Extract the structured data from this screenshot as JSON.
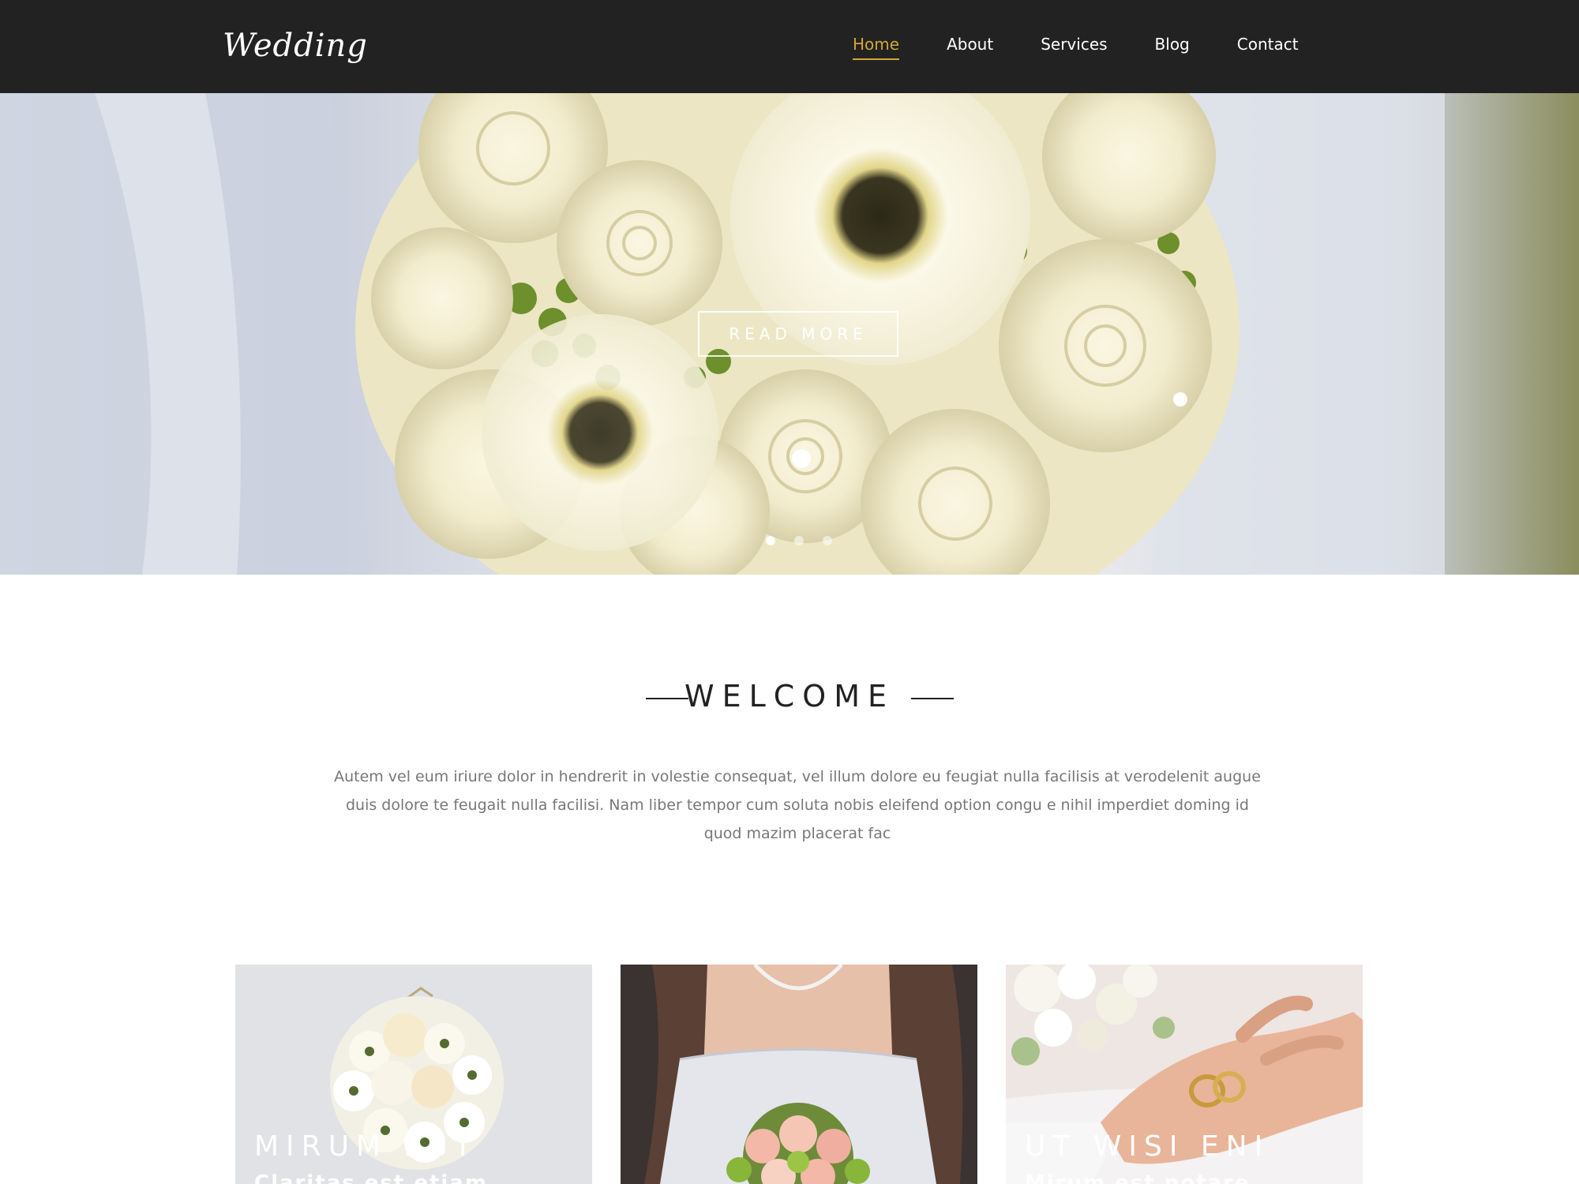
{
  "header": {
    "logo_text": "Wedding",
    "nav": [
      {
        "label": "Home",
        "active": true
      },
      {
        "label": "About",
        "active": false
      },
      {
        "label": "Services",
        "active": false
      },
      {
        "label": "Blog",
        "active": false
      },
      {
        "label": "Contact",
        "active": false
      }
    ]
  },
  "hero": {
    "button_label": "READ MORE",
    "slides": 3,
    "active_slide": 1
  },
  "welcome": {
    "title": "WELCOME",
    "text": "Autem vel eum iriure dolor in hendrerit in volestie consequat, vel illum dolore eu feugiat nulla facilisis at verodelenit augue duis dolore te feugait nulla facilisi. Nam liber tempor cum soluta nobis eleifend option congu e nihil imperdiet doming id quod mazim placerat fac"
  },
  "cards": [
    {
      "title": "MIRUM EST",
      "subtitle": "Claritas est etiam"
    },
    {
      "title": "",
      "subtitle": ""
    },
    {
      "title": "UT WISI ENI",
      "subtitle": "Mirum est notare"
    }
  ],
  "colors": {
    "header_bg": "#222222",
    "accent": "#d4a637",
    "text_dark": "#222222",
    "text_muted": "#777777"
  }
}
